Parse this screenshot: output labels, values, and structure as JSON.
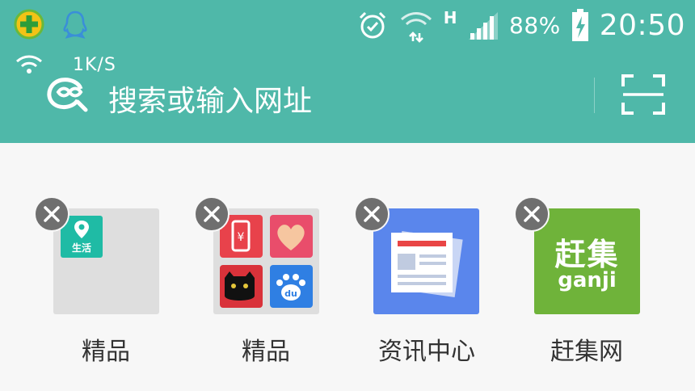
{
  "status_bar": {
    "network_type": "H",
    "battery": "88%",
    "time": "20:50",
    "net_speed": "1K/S"
  },
  "search": {
    "placeholder": "搜索或输入网址"
  },
  "tiles": [
    {
      "label": "精品",
      "badge_text": "生活"
    },
    {
      "label": "精品"
    },
    {
      "label": "资讯中心"
    },
    {
      "label": "赶集网",
      "logo_text": "赶集",
      "logo_subtext": "ganji"
    }
  ],
  "colors": {
    "header_bg": "#4fb8a9",
    "page_bg": "#f7f7f7",
    "close_badge": "#6f6f6f",
    "news_tile": "#5a86ec",
    "ganji_tile": "#6fb33a"
  }
}
